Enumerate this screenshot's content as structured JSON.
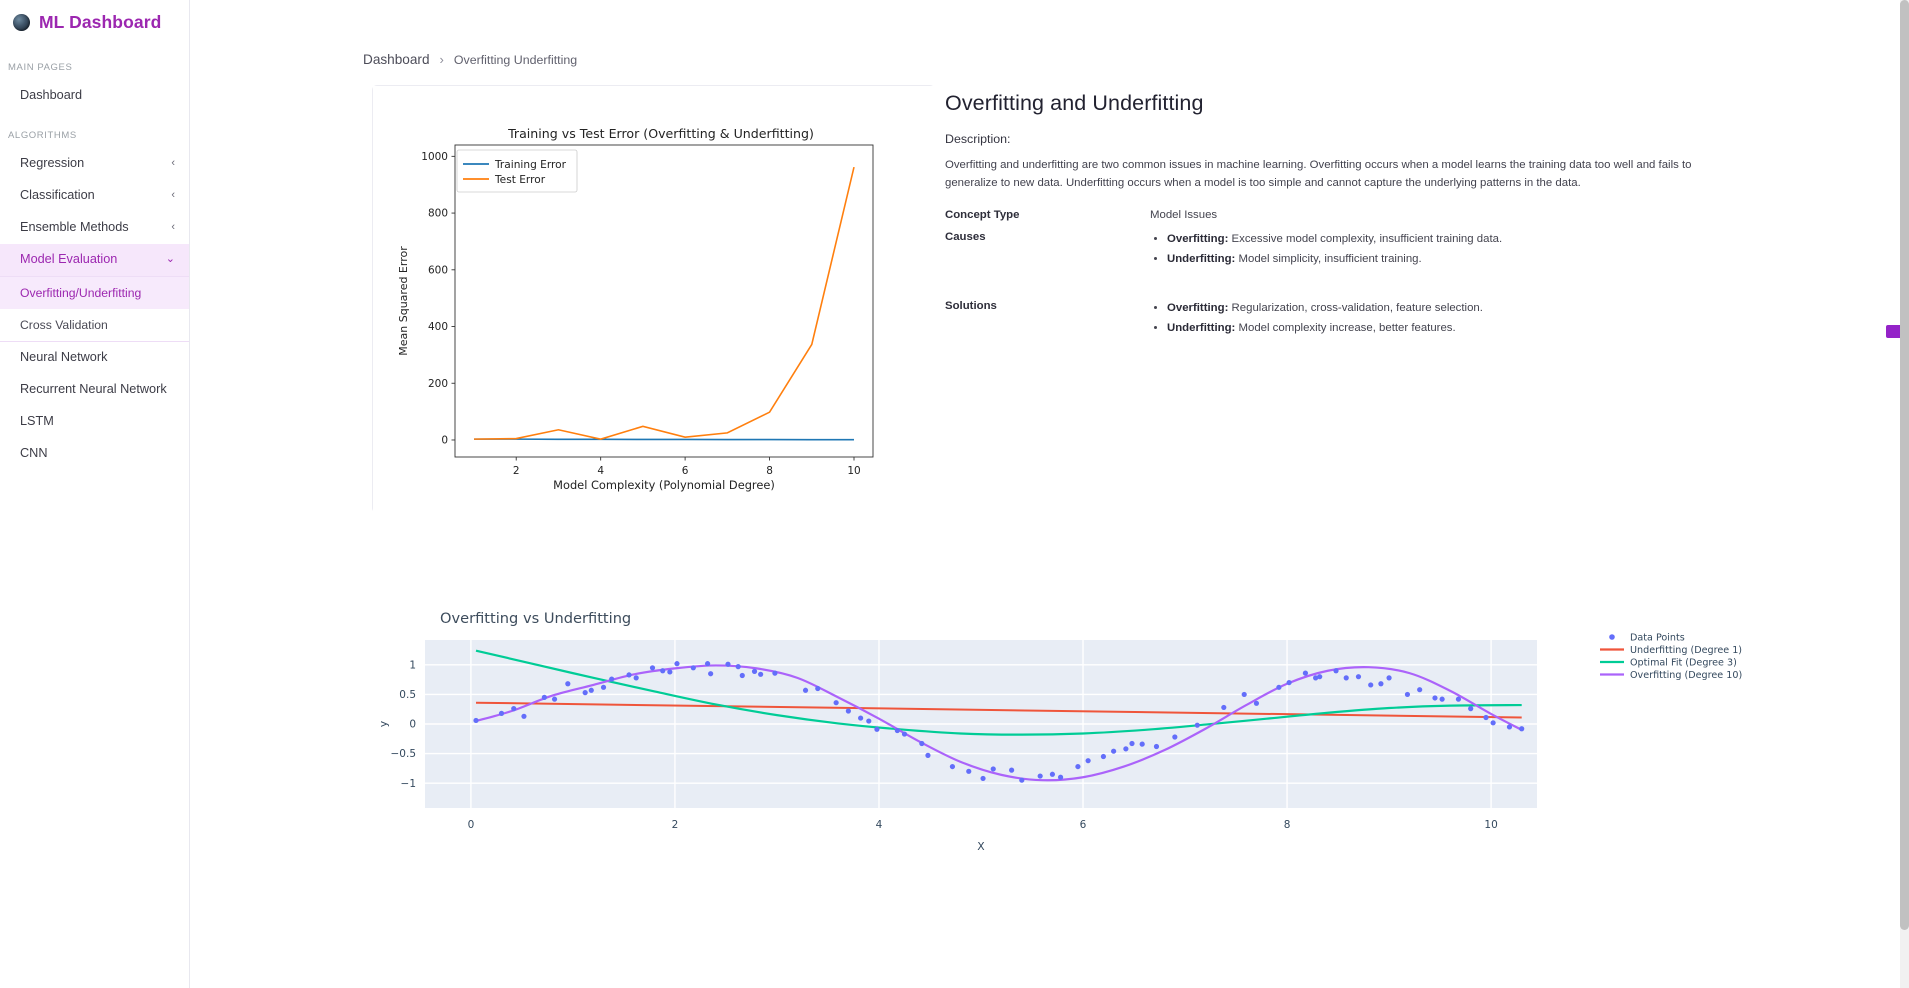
{
  "brand": {
    "title": "ML Dashboard",
    "logo_icon": "globe-icon",
    "accent": "#9c27b0"
  },
  "sidebar": {
    "sections": [
      {
        "label": "MAIN PAGES",
        "items": [
          {
            "label": "Dashboard",
            "chevron": ""
          }
        ]
      },
      {
        "label": "ALGORITHMS",
        "items": [
          {
            "label": "Regression",
            "chevron": "‹"
          },
          {
            "label": "Classification",
            "chevron": "‹"
          },
          {
            "label": "Ensemble Methods",
            "chevron": "‹"
          },
          {
            "label": "Model Evaluation",
            "chevron": "⌄",
            "active": true,
            "children": [
              {
                "label": "Overfitting/Underfitting",
                "selected": true
              },
              {
                "label": "Cross Validation",
                "selected": false
              }
            ]
          },
          {
            "label": "Neural Network",
            "chevron": ""
          },
          {
            "label": "Recurrent Neural Network",
            "chevron": ""
          },
          {
            "label": "LSTM",
            "chevron": ""
          },
          {
            "label": "CNN",
            "chevron": ""
          }
        ]
      }
    ]
  },
  "breadcrumb": {
    "root": "Dashboard",
    "separator": "›",
    "current": "Overfitting Underfitting"
  },
  "info": {
    "title": "Overfitting and Underfitting",
    "description_label": "Description:",
    "description": "Overfitting and underfitting are two common issues in machine learning. Overfitting occurs when a model learns the training data too well and fails to generalize to new data. Underfitting occurs when a model is too simple and cannot capture the underlying patterns in the data.",
    "rows": [
      {
        "key": "Concept Type",
        "value": "Model Issues",
        "bullets": []
      },
      {
        "key": "Causes",
        "value": "",
        "bullets": [
          {
            "term": "Overfitting:",
            "text": " Excessive model complexity, insufficient training data."
          },
          {
            "term": "Underfitting:",
            "text": " Model simplicity, insufficient training."
          }
        ]
      },
      {
        "key": "Solutions",
        "value": "",
        "bullets": [
          {
            "term": "Overfitting:",
            "text": " Regularization, cross-validation, feature selection."
          },
          {
            "term": "Underfitting:",
            "text": " Model complexity increase, better features."
          }
        ]
      }
    ]
  },
  "edge_handle": {
    "name": "panel-toggle-handle",
    "color": "#9423c8"
  },
  "chart_data": [
    {
      "id": "training-vs-test-error",
      "type": "line",
      "title": "Training vs Test Error (Overfitting & Underfitting)",
      "xlabel": "Model Complexity (Polynomial Degree)",
      "ylabel": "Mean Squared Error",
      "x": [
        1,
        2,
        3,
        4,
        5,
        6,
        7,
        8,
        9,
        10
      ],
      "xlim": [
        0.55,
        10.45
      ],
      "ylim": [
        -60,
        1040
      ],
      "xticks": [
        2,
        4,
        6,
        8,
        10
      ],
      "yticks": [
        0,
        200,
        400,
        600,
        800,
        1000
      ],
      "grid": false,
      "legend_position": "upper left",
      "series": [
        {
          "name": "Training Error",
          "color": "#1f77b4",
          "values": [
            3,
            3,
            2.5,
            2.2,
            2.0,
            1.8,
            1.6,
            1.4,
            1.2,
            1.0
          ]
        },
        {
          "name": "Test Error",
          "color": "#ff7f0e",
          "values": [
            3,
            5,
            36,
            3,
            48,
            10,
            25,
            98,
            337,
            962
          ]
        }
      ]
    },
    {
      "id": "overfitting-vs-underfitting",
      "type": "scatter",
      "title": "Overfitting vs Underfitting",
      "xlabel": "X",
      "ylabel": "y",
      "xlim": [
        -0.45,
        10.45
      ],
      "ylim": [
        -1.42,
        1.42
      ],
      "xticks": [
        0,
        2,
        4,
        6,
        8,
        10
      ],
      "yticks": [
        -1,
        -0.5,
        0,
        0.5,
        1
      ],
      "grid": true,
      "plot_bgcolor": "#e8edf5",
      "legend_position": "right",
      "legend": [
        {
          "name": "Data Points",
          "color": "#636efa",
          "mode": "markers"
        },
        {
          "name": "Underfitting (Degree 1)",
          "color": "#ef553b",
          "mode": "lines"
        },
        {
          "name": "Optimal Fit (Degree 3)",
          "color": "#00cc96",
          "mode": "lines"
        },
        {
          "name": "Overfitting (Degree 10)",
          "color": "#ab63fa",
          "mode": "lines"
        }
      ],
      "points": [
        [
          0.05,
          0.06
        ],
        [
          0.3,
          0.18
        ],
        [
          0.42,
          0.26
        ],
        [
          0.52,
          0.13
        ],
        [
          0.72,
          0.45
        ],
        [
          0.82,
          0.42
        ],
        [
          0.95,
          0.68
        ],
        [
          1.12,
          0.53
        ],
        [
          1.18,
          0.57
        ],
        [
          1.3,
          0.62
        ],
        [
          1.38,
          0.76
        ],
        [
          1.55,
          0.83
        ],
        [
          1.62,
          0.78
        ],
        [
          1.78,
          0.95
        ],
        [
          1.88,
          0.9
        ],
        [
          1.95,
          0.88
        ],
        [
          2.02,
          1.02
        ],
        [
          2.18,
          0.95
        ],
        [
          2.32,
          1.02
        ],
        [
          2.35,
          0.85
        ],
        [
          2.52,
          1.01
        ],
        [
          2.62,
          0.97
        ],
        [
          2.66,
          0.82
        ],
        [
          2.78,
          0.89
        ],
        [
          2.84,
          0.84
        ],
        [
          2.98,
          0.86
        ],
        [
          3.28,
          0.57
        ],
        [
          3.4,
          0.6
        ],
        [
          3.58,
          0.36
        ],
        [
          3.7,
          0.22
        ],
        [
          3.82,
          0.1
        ],
        [
          3.9,
          0.05
        ],
        [
          3.98,
          -0.09
        ],
        [
          4.18,
          -0.11
        ],
        [
          4.25,
          -0.17
        ],
        [
          4.42,
          -0.33
        ],
        [
          4.48,
          -0.53
        ],
        [
          4.72,
          -0.72
        ],
        [
          4.88,
          -0.8
        ],
        [
          5.02,
          -0.92
        ],
        [
          5.12,
          -0.76
        ],
        [
          5.3,
          -0.78
        ],
        [
          5.4,
          -0.95
        ],
        [
          5.58,
          -0.88
        ],
        [
          5.7,
          -0.85
        ],
        [
          5.78,
          -0.9
        ],
        [
          5.95,
          -0.72
        ],
        [
          6.05,
          -0.62
        ],
        [
          6.2,
          -0.55
        ],
        [
          6.3,
          -0.46
        ],
        [
          6.42,
          -0.42
        ],
        [
          6.48,
          -0.33
        ],
        [
          6.58,
          -0.34
        ],
        [
          6.72,
          -0.38
        ],
        [
          6.9,
          -0.22
        ],
        [
          7.12,
          -0.02
        ],
        [
          7.38,
          0.28
        ],
        [
          7.58,
          0.5
        ],
        [
          7.7,
          0.35
        ],
        [
          7.92,
          0.62
        ],
        [
          8.02,
          0.7
        ],
        [
          8.18,
          0.86
        ],
        [
          8.28,
          0.78
        ],
        [
          8.32,
          0.8
        ],
        [
          8.48,
          0.9
        ],
        [
          8.58,
          0.78
        ],
        [
          8.7,
          0.8
        ],
        [
          8.82,
          0.66
        ],
        [
          8.92,
          0.68
        ],
        [
          9.0,
          0.78
        ],
        [
          9.18,
          0.5
        ],
        [
          9.3,
          0.58
        ],
        [
          9.45,
          0.44
        ],
        [
          9.52,
          0.42
        ],
        [
          9.68,
          0.42
        ],
        [
          9.8,
          0.26
        ],
        [
          9.95,
          0.11
        ],
        [
          10.02,
          0.02
        ],
        [
          10.18,
          -0.05
        ],
        [
          10.3,
          -0.08
        ]
      ],
      "fits": {
        "underfitting_degree1": {
          "color": "#ef553b",
          "endpoints": [
            [
              0.05,
              0.36
            ],
            [
              10.3,
              0.11
            ]
          ]
        },
        "optimal_degree3": {
          "color": "#00cc96",
          "samples": [
            [
              0.05,
              1.24
            ],
            [
              0.6,
              1.02
            ],
            [
              1.2,
              0.78
            ],
            [
              1.8,
              0.55
            ],
            [
              2.4,
              0.33
            ],
            [
              3.0,
              0.15
            ],
            [
              3.6,
              0.01
            ],
            [
              4.2,
              -0.09
            ],
            [
              4.8,
              -0.16
            ],
            [
              5.4,
              -0.18
            ],
            [
              6.0,
              -0.16
            ],
            [
              6.6,
              -0.1
            ],
            [
              7.2,
              -0.01
            ],
            [
              7.8,
              0.09
            ],
            [
              8.4,
              0.19
            ],
            [
              9.0,
              0.27
            ],
            [
              9.6,
              0.31
            ],
            [
              10.3,
              0.32
            ]
          ]
        },
        "overfitting_degree10": {
          "color": "#ab63fa",
          "samples": [
            [
              0.05,
              0.05
            ],
            [
              0.4,
              0.22
            ],
            [
              0.8,
              0.48
            ],
            [
              1.2,
              0.66
            ],
            [
              1.6,
              0.84
            ],
            [
              2.0,
              0.94
            ],
            [
              2.4,
              0.99
            ],
            [
              2.8,
              0.94
            ],
            [
              3.2,
              0.78
            ],
            [
              3.6,
              0.45
            ],
            [
              4.0,
              0.09
            ],
            [
              4.4,
              -0.3
            ],
            [
              4.8,
              -0.64
            ],
            [
              5.2,
              -0.86
            ],
            [
              5.6,
              -0.95
            ],
            [
              6.0,
              -0.9
            ],
            [
              6.4,
              -0.72
            ],
            [
              6.8,
              -0.44
            ],
            [
              7.2,
              -0.08
            ],
            [
              7.6,
              0.32
            ],
            [
              8.0,
              0.68
            ],
            [
              8.4,
              0.9
            ],
            [
              8.8,
              0.96
            ],
            [
              9.2,
              0.86
            ],
            [
              9.6,
              0.56
            ],
            [
              10.0,
              0.17
            ],
            [
              10.3,
              -0.1
            ]
          ]
        }
      }
    }
  ]
}
